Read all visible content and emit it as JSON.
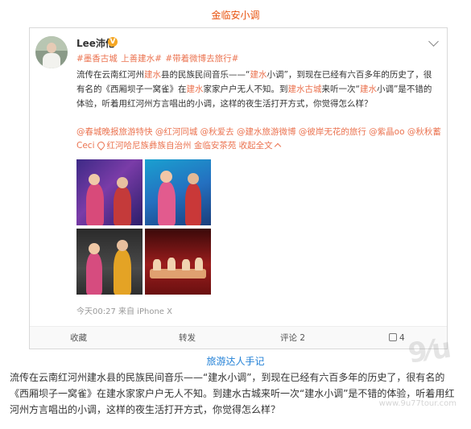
{
  "page_title": "金临安小调",
  "post": {
    "username": "Lee沛伦",
    "vip_badge": "V",
    "tags": [
      "#墨香古城",
      "上善建水#",
      "#带着微博去旅行#"
    ],
    "text_parts": [
      {
        "t": "流传在云南红河州",
        "kw": false
      },
      {
        "t": "建水",
        "kw": true
      },
      {
        "t": "县的民族民间音乐——“",
        "kw": false
      },
      {
        "t": "建水",
        "kw": true
      },
      {
        "t": "小调”，到现在已经有六百多年的历史了，很有名的《西厢坝子一窝雀》在",
        "kw": false
      },
      {
        "t": "建水",
        "kw": true
      },
      {
        "t": "家家户户无人不知。到",
        "kw": false
      },
      {
        "t": "建水古城",
        "kw": true
      },
      {
        "t": "来听一次“",
        "kw": false
      },
      {
        "t": "建水",
        "kw": true
      },
      {
        "t": "小调”是不错的体验，听着用红河州方言唱出的小调，这样的夜生活打开方式，你觉得怎么样？",
        "kw": false
      }
    ],
    "mentions": "@春城晚报旅游特快 @红河同城 @秋爱去 @建水旅游微博 @彼岸无花的旅行 @紫晶oo @秋秋蓄Ceci",
    "location": "红河哈尼族彝族自治州 金临安茶苑",
    "collapse_label": "收起全文",
    "meta": "今天00:27 来自 iPhone X",
    "actions": {
      "favorite": "收藏",
      "repost": "转发",
      "comment": "评论 2",
      "like_count": "4"
    }
  },
  "article": {
    "caption": "旅游达人手记",
    "paragraph": "流传在云南红河州建水县的民族民间音乐——“建水小调”，到现在已经有六百多年的历史了，很有名的《西厢坝子一窝雀》在建水家家户户无人不知。到建水古城来听一次“建水小调”是不错的体验，听着用红河州方言唱出的小调，这样的夜生活打开方式，你觉得怎么样？"
  },
  "watermark": {
    "logo": "9⁄u",
    "url": "www.9u77tour.com"
  },
  "colors": {
    "accent": "#eb7350",
    "title": "#e8530e",
    "caption": "#1f7fd6"
  }
}
